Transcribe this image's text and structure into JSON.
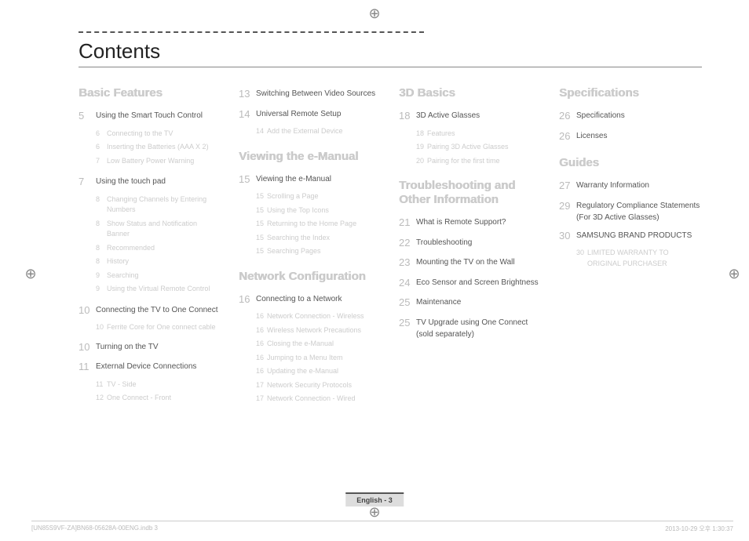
{
  "title": "Contents",
  "footer_center": "English - 3",
  "footer_left": "[UN85S9VF-ZA]BN68-05628A-00ENG.indb   3",
  "footer_right": "2013-10-29   오후 1:30:37",
  "sections": {
    "basic_features": {
      "title": "Basic Features",
      "e5": "Using the Smart Touch Control",
      "s6a": "Connecting to the TV",
      "s6b": "Inserting the Batteries (AAA X 2)",
      "s7": "Low Battery Power Warning",
      "e7": "Using the touch pad",
      "s8a": "Changing Channels by Entering Numbers",
      "s8b": "Show Status and Notification Banner",
      "s8c": "Recommended",
      "s8d": "History",
      "s9a": "Searching",
      "s9b": "Using the Virtual Remote Control",
      "e10": "Connecting the TV to One Connect",
      "s10": "Ferrite Core for One connect cable",
      "e10b": "Turning on the TV",
      "e11": "External Device Connections",
      "s11": "TV - Side",
      "s12": "One Connect - Front",
      "e13": "Switching Between Video Sources",
      "e14": "Universal Remote Setup",
      "s14": "Add the External Device"
    },
    "viewing": {
      "title": "Viewing the e-Manual",
      "e15": "Viewing the e-Manual",
      "s15a": "Scrolling a Page",
      "s15b": "Using the Top Icons",
      "s15c": "Returning to the Home Page",
      "s15d": "Searching the Index",
      "s15e": "Searching Pages"
    },
    "network": {
      "title": "Network Configuration",
      "e16": "Connecting to a Network",
      "s16a": "Network Connection - Wireless",
      "s16b": "Wireless Network Precautions",
      "s16c": "Closing the e-Manual",
      "s16d": "Jumping to a Menu Item",
      "s16e": "Updating the e-Manual",
      "s17a": "Network Security Protocols",
      "s17b": "Network Connection - Wired"
    },
    "threed": {
      "title": "3D Basics",
      "e18": "3D Active Glasses",
      "s18": "Features",
      "s19": "Pairing 3D Active Glasses",
      "s20": "Pairing for the first time"
    },
    "troubleshoot": {
      "title": "Troubleshooting and Other Information",
      "e21": "What is Remote Support?",
      "e22": "Troubleshooting",
      "e23": "Mounting the TV on the Wall",
      "e24": "Eco Sensor and Screen Brightness",
      "e25a": "Maintenance",
      "e25b": "TV Upgrade using One Connect (sold separately)"
    },
    "specs": {
      "title": "Specifications",
      "e26a": "Specifications",
      "e26b": "Licenses"
    },
    "guides": {
      "title": "Guides",
      "e27": "Warranty Information",
      "e29": "Regulatory Compliance Statements (For 3D Active Glasses)",
      "e30": "SAMSUNG BRAND PRODUCTS",
      "s30": "LIMITED WARRANTY TO ORIGINAL PURCHASER"
    }
  }
}
